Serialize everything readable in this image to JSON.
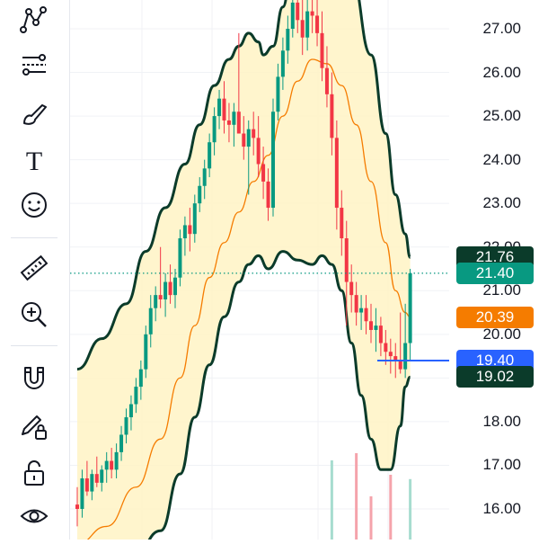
{
  "toolbar": {
    "tools": [
      {
        "name": "pattern-tool",
        "icon": "pattern-icon"
      },
      {
        "name": "fib-tool",
        "icon": "fib-retracement-icon"
      },
      {
        "name": "brush-tool",
        "icon": "brush-icon"
      },
      {
        "name": "text-tool",
        "icon": "text-icon"
      },
      {
        "name": "emoji-tool",
        "icon": "smiley-icon"
      },
      {
        "name": "ruler-tool",
        "icon": "ruler-icon"
      },
      {
        "name": "zoom-tool",
        "icon": "zoom-in-icon"
      },
      {
        "name": "magnet-tool",
        "icon": "magnet-icon"
      },
      {
        "name": "lock-drawing-tool",
        "icon": "pencil-lock-icon"
      },
      {
        "name": "lock-all-tool",
        "icon": "padlock-icon"
      },
      {
        "name": "visibility-tool",
        "icon": "eye-icon"
      }
    ],
    "text_tool_glyph": "T"
  },
  "price_axis": {
    "ticks": [
      "27.00",
      "26.00",
      "25.00",
      "24.00",
      "23.00",
      "22.00",
      "21.00",
      "20.00",
      "19.00",
      "18.00",
      "17.00",
      "16.00"
    ],
    "tags": [
      {
        "label": "21.76",
        "value": 21.76,
        "color": "#0b3b2a"
      },
      {
        "label": "21.40",
        "value": 21.4,
        "color": "#089981"
      },
      {
        "label": "20.39",
        "value": 20.39,
        "color": "#f57c00"
      },
      {
        "label": "19.40",
        "value": 19.4,
        "color": "#2962ff"
      },
      {
        "label": "19.02",
        "value": 19.02,
        "color": "#0b3b2a"
      }
    ]
  },
  "colors": {
    "up": "#089981",
    "down": "#f23645",
    "band_fill": "#fff3c4",
    "band_line": "#0b3b2a",
    "basis_line": "#f57c00",
    "position_line": "#2962ff"
  },
  "chart_data": {
    "type": "candlestick",
    "ylim": [
      15.4,
      28.0
    ],
    "last_price": 21.4,
    "position_price": 19.4,
    "ohlc": [
      [
        16.1,
        16.5,
        15.6,
        16.0
      ],
      [
        16.0,
        16.9,
        15.8,
        16.7
      ],
      [
        16.7,
        17.1,
        16.3,
        16.4
      ],
      [
        16.4,
        16.9,
        16.2,
        16.8
      ],
      [
        16.8,
        17.2,
        16.5,
        16.6
      ],
      [
        16.6,
        17.0,
        16.4,
        16.9
      ],
      [
        16.9,
        17.3,
        16.6,
        17.1
      ],
      [
        17.1,
        17.4,
        16.7,
        16.9
      ],
      [
        16.9,
        17.5,
        16.7,
        17.3
      ],
      [
        17.3,
        17.9,
        17.1,
        17.7
      ],
      [
        17.7,
        18.3,
        17.5,
        18.1
      ],
      [
        18.1,
        18.6,
        17.8,
        18.4
      ],
      [
        18.4,
        19.0,
        18.2,
        18.8
      ],
      [
        18.8,
        19.4,
        18.5,
        19.2
      ],
      [
        19.2,
        20.2,
        19.0,
        20.0
      ],
      [
        20.0,
        20.9,
        19.7,
        20.6
      ],
      [
        20.6,
        21.1,
        20.3,
        20.9
      ],
      [
        20.9,
        22.0,
        20.6,
        20.8
      ],
      [
        20.8,
        21.4,
        20.4,
        21.2
      ],
      [
        21.2,
        21.6,
        20.7,
        20.9
      ],
      [
        20.9,
        21.5,
        20.6,
        21.3
      ],
      [
        21.3,
        22.4,
        21.1,
        22.2
      ],
      [
        22.2,
        22.7,
        21.8,
        22.5
      ],
      [
        22.5,
        22.9,
        21.9,
        22.3
      ],
      [
        22.3,
        23.2,
        22.1,
        23.0
      ],
      [
        23.0,
        23.6,
        22.8,
        23.4
      ],
      [
        23.4,
        24.0,
        23.1,
        23.8
      ],
      [
        23.8,
        24.6,
        23.6,
        24.4
      ],
      [
        24.4,
        25.2,
        24.1,
        25.0
      ],
      [
        25.0,
        25.6,
        24.7,
        25.4
      ],
      [
        25.4,
        25.8,
        24.6,
        24.9
      ],
      [
        24.9,
        25.3,
        24.4,
        24.8
      ],
      [
        24.8,
        25.3,
        24.3,
        25.1
      ],
      [
        25.1,
        26.9,
        24.9,
        24.6
      ],
      [
        24.6,
        25.0,
        24.0,
        24.3
      ],
      [
        24.3,
        24.9,
        23.2,
        24.7
      ],
      [
        24.7,
        25.1,
        24.1,
        24.5
      ],
      [
        24.5,
        25.0,
        23.6,
        23.9
      ],
      [
        23.9,
        24.3,
        23.1,
        23.5
      ],
      [
        23.5,
        23.8,
        22.6,
        22.9
      ],
      [
        22.9,
        25.4,
        22.7,
        25.1
      ],
      [
        25.1,
        26.2,
        24.9,
        25.9
      ],
      [
        25.9,
        26.8,
        25.6,
        26.5
      ],
      [
        26.5,
        27.3,
        26.2,
        27.0
      ],
      [
        27.0,
        28.0,
        26.8,
        27.6
      ],
      [
        27.6,
        28.0,
        26.9,
        27.2
      ],
      [
        27.2,
        28.0,
        26.4,
        26.8
      ],
      [
        26.8,
        28.0,
        26.5,
        27.4
      ],
      [
        27.4,
        28.0,
        26.9,
        27.3
      ],
      [
        27.3,
        28.0,
        26.6,
        26.9
      ],
      [
        26.9,
        27.4,
        25.8,
        26.1
      ],
      [
        26.1,
        26.6,
        25.2,
        25.5
      ],
      [
        25.5,
        26.0,
        24.1,
        24.5
      ],
      [
        24.5,
        24.9,
        22.4,
        22.9
      ],
      [
        22.9,
        23.3,
        21.8,
        22.2
      ],
      [
        22.2,
        22.6,
        20.2,
        21.2
      ],
      [
        21.2,
        21.6,
        20.5,
        20.9
      ],
      [
        20.9,
        21.2,
        20.2,
        20.5
      ],
      [
        20.5,
        20.9,
        20.1,
        20.6
      ],
      [
        20.6,
        20.9,
        20.0,
        20.3
      ],
      [
        20.3,
        20.7,
        19.8,
        20.1
      ],
      [
        20.1,
        20.6,
        19.6,
        20.2
      ],
      [
        20.2,
        20.4,
        19.5,
        19.8
      ],
      [
        19.8,
        20.1,
        19.3,
        19.6
      ],
      [
        19.6,
        19.9,
        19.1,
        19.5
      ],
      [
        19.5,
        19.8,
        19.0,
        19.4
      ],
      [
        19.4,
        20.5,
        19.1,
        19.2
      ],
      [
        19.2,
        20.7,
        19.0,
        19.8
      ],
      [
        19.8,
        21.5,
        19.4,
        21.4
      ]
    ],
    "bollinger_upper": [
      [
        0,
        19.2
      ],
      [
        5,
        19.9
      ],
      [
        10,
        20.7
      ],
      [
        14,
        21.9
      ],
      [
        18,
        22.9
      ],
      [
        22,
        23.9
      ],
      [
        25,
        24.8
      ],
      [
        28,
        25.7
      ],
      [
        31,
        26.3
      ],
      [
        33,
        26.6
      ],
      [
        35,
        26.9
      ],
      [
        37,
        26.7
      ],
      [
        38,
        26.4
      ],
      [
        40,
        26.6
      ],
      [
        42,
        27.5
      ],
      [
        44,
        28.6
      ],
      [
        48,
        29.4
      ],
      [
        52,
        29.2
      ],
      [
        56,
        28.2
      ],
      [
        60,
        26.4
      ],
      [
        63,
        24.6
      ],
      [
        65,
        23.2
      ],
      [
        67,
        22.3
      ],
      [
        68,
        21.76
      ]
    ],
    "bollinger_basis": [
      [
        0,
        15.2
      ],
      [
        6,
        15.6
      ],
      [
        12,
        16.5
      ],
      [
        17,
        17.6
      ],
      [
        21,
        19.0
      ],
      [
        24,
        20.2
      ],
      [
        27,
        21.3
      ],
      [
        30,
        22.1
      ],
      [
        33,
        22.8
      ],
      [
        36,
        23.5
      ],
      [
        39,
        24.1
      ],
      [
        42,
        25.0
      ],
      [
        45,
        25.8
      ],
      [
        48,
        26.3
      ],
      [
        51,
        26.2
      ],
      [
        54,
        25.7
      ],
      [
        57,
        24.8
      ],
      [
        60,
        23.5
      ],
      [
        63,
        22.1
      ],
      [
        65,
        21.0
      ],
      [
        67,
        20.5
      ],
      [
        68,
        20.39
      ]
    ],
    "bollinger_lower": [
      [
        0,
        14.6
      ],
      [
        6,
        14.8
      ],
      [
        12,
        15.0
      ],
      [
        17,
        15.5
      ],
      [
        21,
        16.8
      ],
      [
        24,
        18.1
      ],
      [
        27,
        19.3
      ],
      [
        30,
        20.4
      ],
      [
        33,
        21.2
      ],
      [
        35,
        21.6
      ],
      [
        37,
        21.8
      ],
      [
        39,
        21.5
      ],
      [
        42,
        21.9
      ],
      [
        45,
        21.7
      ],
      [
        48,
        21.6
      ],
      [
        50,
        21.8
      ],
      [
        52,
        21.6
      ],
      [
        54,
        21.0
      ],
      [
        56,
        19.8
      ],
      [
        58,
        18.6
      ],
      [
        60,
        17.6
      ],
      [
        62,
        16.9
      ],
      [
        64,
        16.9
      ],
      [
        66,
        17.9
      ],
      [
        67,
        18.8
      ],
      [
        68,
        19.02
      ]
    ],
    "volume_bars": [
      {
        "index": 52,
        "value": 0.55,
        "color": "#a7dccf"
      },
      {
        "index": 57,
        "value": 0.6,
        "color": "#f5a3ab"
      },
      {
        "index": 60,
        "value": 0.3,
        "color": "#f5a3ab"
      },
      {
        "index": 64,
        "value": 0.45,
        "color": "#f5a3ab"
      },
      {
        "index": 68,
        "value": 0.42,
        "color": "#a7dccf"
      }
    ]
  }
}
